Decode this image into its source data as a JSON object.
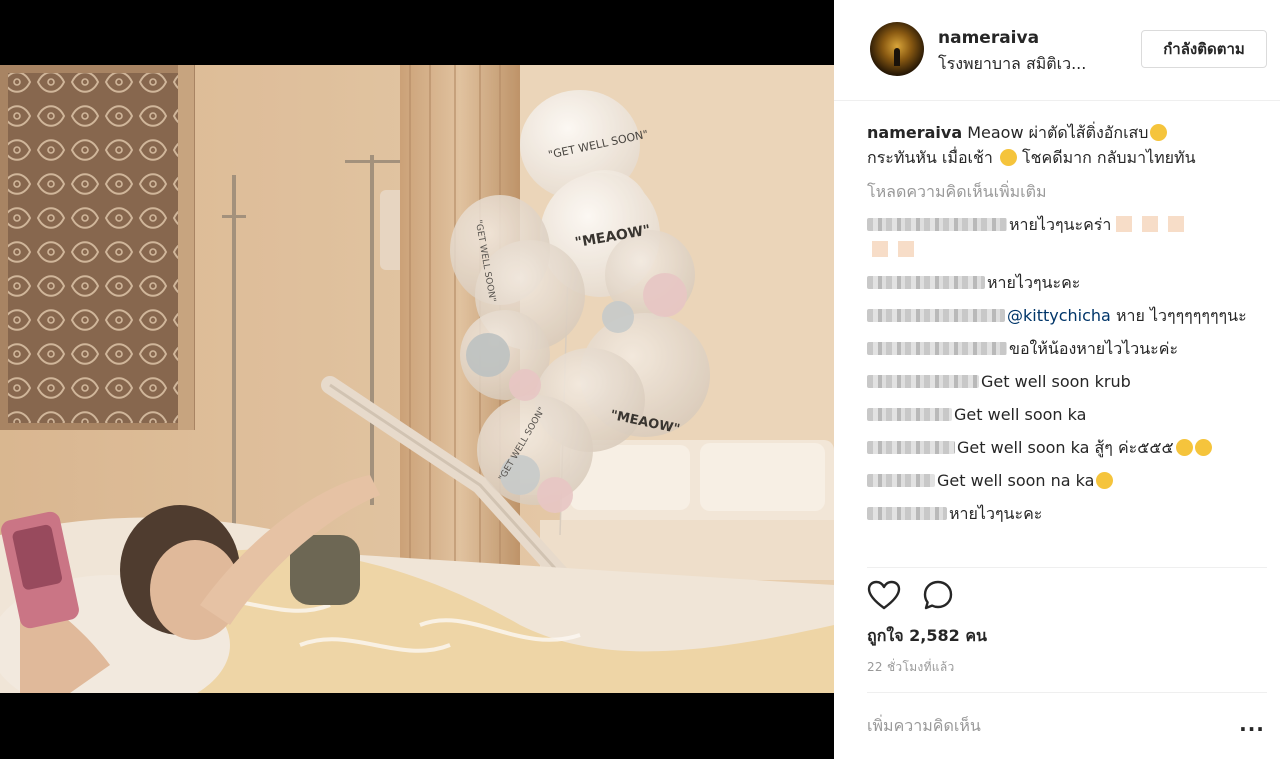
{
  "header": {
    "username": "nameraiva",
    "location": "โรงพยาบาล สมิติเว...",
    "follow_label": "กำลังติดตาม"
  },
  "caption": {
    "username": "nameraiva",
    "text": " Meaow ผ่าตัดไส้ติ่งอักเสบ",
    "text2": " กระทันหัน เมื่อเช้า",
    "text3": " โชคดีมาก กลับมาไทยทัน"
  },
  "load_more_label": "โหลดความคิดเห็นเพิ่มเติม",
  "comments": [
    {
      "text": "หายไวๆนะคร่า"
    },
    {
      "text": "หายไวๆนะคะ"
    },
    {
      "mention": "@kittychicha",
      "text": " หาย ไวๆๆๆๆๆๆๆนะ"
    },
    {
      "text": "ขอให้น้องหายไวไวนะค่ะ"
    },
    {
      "text": "Get well soon krub"
    },
    {
      "text": "Get well soon ka"
    },
    {
      "text": "Get well soon ka สู้ๆ ค่ะ๕๕๕"
    },
    {
      "text": "Get well soon na ka"
    },
    {
      "text": "หายไวๆนะคะ"
    }
  ],
  "likes_text": "ถูกใจ 2,582 คน",
  "timestamp": "22 ชั่วโมงที่แล้ว",
  "add_comment_placeholder": "เพิ่มความคิดเห็น",
  "more_options": "...",
  "photo": {
    "balloon_texts": [
      "\"GET WELL SOON\"",
      "\"MEAOW\"",
      "\"GET WELL SOON\"",
      "\"MEAOW\"",
      "\"GET WELL SOON\""
    ]
  },
  "icons": {
    "heart": "heart-outline-icon",
    "comment": "speech-bubble-icon",
    "more": "ellipsis-icon"
  },
  "colors": {
    "link": "#003569",
    "muted": "#999999",
    "text": "#262626"
  }
}
